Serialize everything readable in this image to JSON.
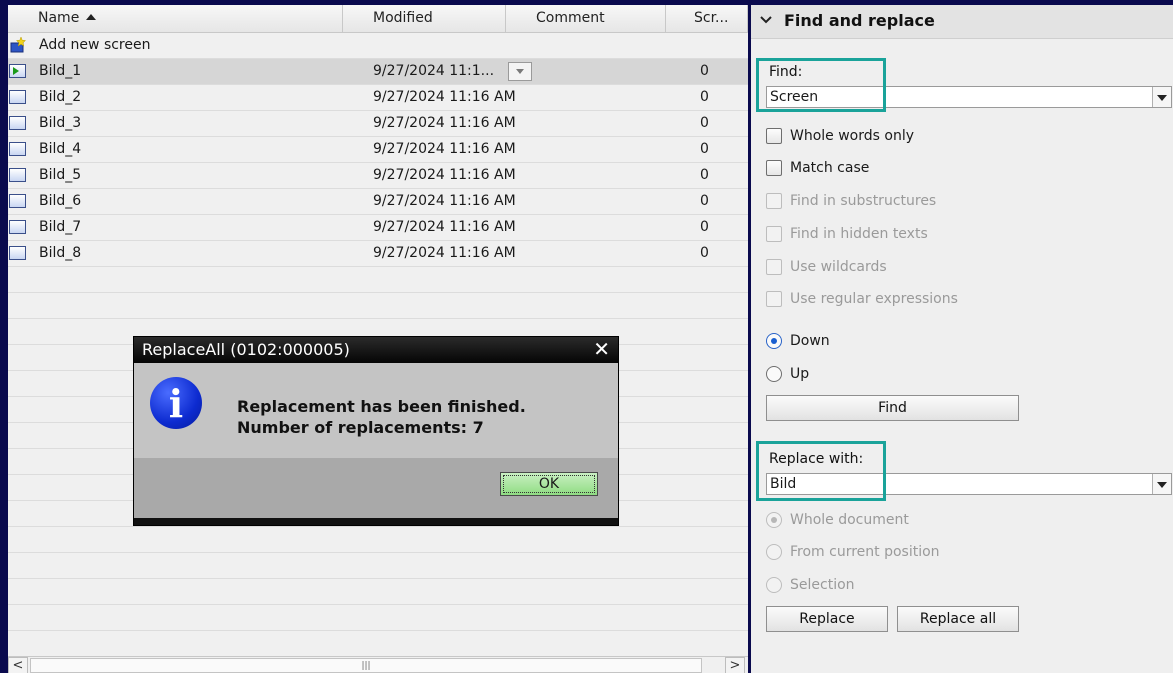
{
  "columns": {
    "name": "Name",
    "modified": "Modified",
    "comment": "Comment",
    "scr": "Scr..."
  },
  "add_new_label": "Add new screen",
  "rows": [
    {
      "name": "Bild_1",
      "modified": "9/27/2024 11:1...",
      "scr": "0",
      "selected": true
    },
    {
      "name": "Bild_2",
      "modified": "9/27/2024 11:16 AM",
      "scr": "0"
    },
    {
      "name": "Bild_3",
      "modified": "9/27/2024 11:16 AM",
      "scr": "0"
    },
    {
      "name": "Bild_4",
      "modified": "9/27/2024 11:16 AM",
      "scr": "0"
    },
    {
      "name": "Bild_5",
      "modified": "9/27/2024 11:16 AM",
      "scr": "0"
    },
    {
      "name": "Bild_6",
      "modified": "9/27/2024 11:16 AM",
      "scr": "0"
    },
    {
      "name": "Bild_7",
      "modified": "9/27/2024 11:16 AM",
      "scr": "0"
    },
    {
      "name": "Bild_8",
      "modified": "9/27/2024 11:16 AM",
      "scr": "0"
    }
  ],
  "scrollbar": {
    "left": "<",
    "right": ">",
    "grip": "|||"
  },
  "find_replace": {
    "title": "Find and replace",
    "find_label": "Find:",
    "find_value": "Screen",
    "whole_words": "Whole words only",
    "match_case": "Match case",
    "find_in_substructures": "Find in substructures",
    "find_in_hidden_texts": "Find in hidden texts",
    "use_wildcards": "Use wildcards",
    "use_regex": "Use regular expressions",
    "down": "Down",
    "up": "Up",
    "find_button": "Find",
    "replace_with_label": "Replace with:",
    "replace_value": "Bild",
    "whole_document": "Whole document",
    "from_current_position": "From current position",
    "selection": "Selection",
    "replace_button": "Replace",
    "replace_all_button": "Replace all"
  },
  "dialog": {
    "title": "ReplaceAll (0102:000005)",
    "close": "✕",
    "icon_glyph": "i",
    "line1": "Replacement has been finished.",
    "line2": "Number of replacements: 7",
    "ok": "OK"
  },
  "colors": {
    "background": "#0a0a4e",
    "highlight": "#1aa39a",
    "ok_button": "#8fdc82",
    "info_icon": "#0d2bd0"
  }
}
